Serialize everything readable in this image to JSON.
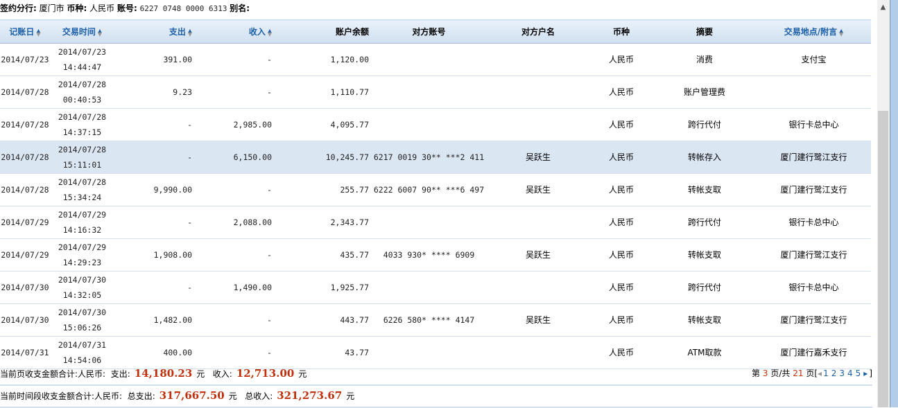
{
  "info": {
    "branch_label": "签约分行:",
    "branch": "厦门市",
    "currency_label": "币种:",
    "currency": "人民币",
    "account_label": "账号:",
    "account": "6227 0748 0000 6313",
    "alias_label": "别名:"
  },
  "columns": [
    "记账日",
    "交易时间",
    "支出",
    "收入",
    "账户余额",
    "对方账号",
    "对方户名",
    "币种",
    "摘要",
    "交易地点/附言"
  ],
  "rows": [
    {
      "date": "2014/07/23",
      "tdate": "2014/07/23",
      "ttime": "14:44:47",
      "out": "391.00",
      "in": "-",
      "bal": "1,120.00",
      "acct": "",
      "name": "",
      "cur": "人民币",
      "memo": "消费",
      "place": "支付宝"
    },
    {
      "date": "2014/07/28",
      "tdate": "2014/07/28",
      "ttime": "00:40:53",
      "out": "9.23",
      "in": "-",
      "bal": "1,110.77",
      "acct": "",
      "name": "",
      "cur": "人民币",
      "memo": "账户管理费",
      "place": ""
    },
    {
      "date": "2014/07/28",
      "tdate": "2014/07/28",
      "ttime": "14:37:15",
      "out": "-",
      "in": "2,985.00",
      "bal": "4,095.77",
      "acct": "",
      "name": "",
      "cur": "人民币",
      "memo": "跨行代付",
      "place": "银行卡总中心"
    },
    {
      "date": "2014/07/28",
      "tdate": "2014/07/28",
      "ttime": "15:11:01",
      "out": "-",
      "in": "6,150.00",
      "bal": "10,245.77",
      "acct": "6217 0019 30** ***2 411",
      "name": "吴跃生",
      "cur": "人民币",
      "memo": "转帐存入",
      "place": "厦门建行鹭江支行"
    },
    {
      "date": "2014/07/28",
      "tdate": "2014/07/28",
      "ttime": "15:34:24",
      "out": "9,990.00",
      "in": "-",
      "bal": "255.77",
      "acct": "6222 6007 90** ***6 497",
      "name": "吴跃生",
      "cur": "人民币",
      "memo": "转帐支取",
      "place": "厦门建行鹭江支行"
    },
    {
      "date": "2014/07/29",
      "tdate": "2014/07/29",
      "ttime": "14:16:32",
      "out": "-",
      "in": "2,088.00",
      "bal": "2,343.77",
      "acct": "",
      "name": "",
      "cur": "人民币",
      "memo": "跨行代付",
      "place": "银行卡总中心"
    },
    {
      "date": "2014/07/29",
      "tdate": "2014/07/29",
      "ttime": "14:29:23",
      "out": "1,908.00",
      "in": "-",
      "bal": "435.77",
      "acct": "4033 930* **** 6909",
      "name": "吴跃生",
      "cur": "人民币",
      "memo": "转帐支取",
      "place": "厦门建行鹭江支行"
    },
    {
      "date": "2014/07/30",
      "tdate": "2014/07/30",
      "ttime": "14:32:05",
      "out": "-",
      "in": "1,490.00",
      "bal": "1,925.77",
      "acct": "",
      "name": "",
      "cur": "人民币",
      "memo": "跨行代付",
      "place": "银行卡总中心"
    },
    {
      "date": "2014/07/30",
      "tdate": "2014/07/30",
      "ttime": "15:06:26",
      "out": "1,482.00",
      "in": "-",
      "bal": "443.77",
      "acct": "6226 580* **** 4147",
      "name": "吴跃生",
      "cur": "人民币",
      "memo": "转帐支取",
      "place": "厦门建行鹭江支行"
    },
    {
      "date": "2014/07/31",
      "tdate": "2014/07/31",
      "ttime": "14:54:06",
      "out": "400.00",
      "in": "-",
      "bal": "43.77",
      "acct": "",
      "name": "",
      "cur": "人民币",
      "memo": "ATM取款",
      "place": "厦门建行嘉禾支行"
    }
  ],
  "page_sum": {
    "label": "当前页收支金额合计:人民币:",
    "out_label": "支出:",
    "out": "14,180.23",
    "unit": "元",
    "in_label": "收入:",
    "in": "12,713.00"
  },
  "period_sum": {
    "label": "当前时间段收支金额合计:人民币:",
    "out_label": "总支出:",
    "out": "317,667.50",
    "unit": "元",
    "in_label": "总收入:",
    "in": "321,273.67"
  },
  "pager": {
    "prefix": "第",
    "current": "3",
    "mid": "页/共",
    "total": "21",
    "suffix": "页",
    "pages": [
      "1",
      "2",
      "3",
      "4",
      "5"
    ]
  }
}
